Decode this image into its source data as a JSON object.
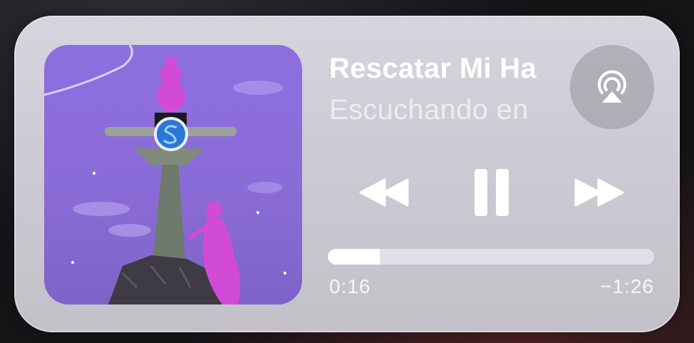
{
  "now_playing": {
    "title": "Rescatar Mi Ha",
    "subtitle": "Escuchando en",
    "artwork_icon": "album-artwork-image"
  },
  "airplay": {
    "icon": "airplay-audio-icon"
  },
  "controls": {
    "rewind_icon": "rewind-icon",
    "pause_icon": "pause-icon",
    "forward_icon": "fast-forward-icon"
  },
  "progress": {
    "fraction": 0.16,
    "elapsed": "0:16",
    "remaining": "−1:26"
  },
  "colors": {
    "card": "#d1cfd7",
    "progress_fill": "#ffffff",
    "progress_track": "#ebe8f0",
    "text_primary": "#ffffff",
    "artwork_purple": "#8a6ad8",
    "figure_pink": "#d24bd6"
  }
}
